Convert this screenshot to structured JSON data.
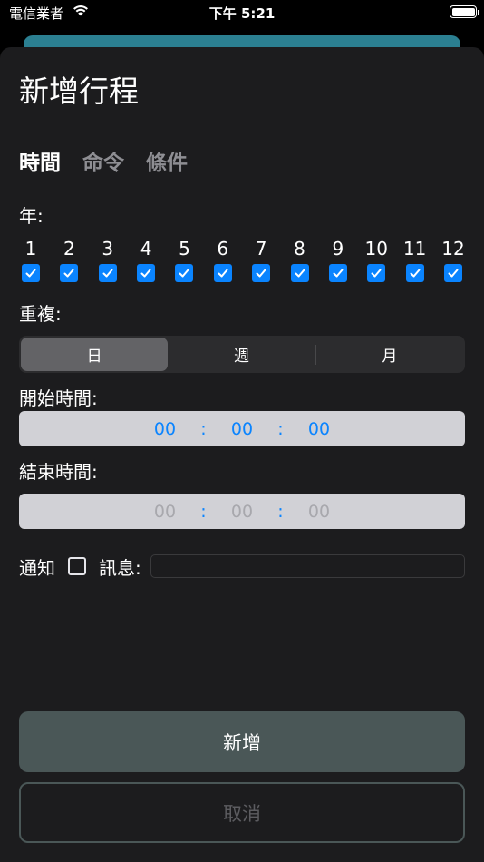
{
  "status_bar": {
    "carrier": "電信業者",
    "time": "下午 5:21"
  },
  "header": {
    "title": "新增行程"
  },
  "tabs": [
    {
      "label": "時間",
      "active": true
    },
    {
      "label": "命令",
      "active": false
    },
    {
      "label": "條件",
      "active": false
    }
  ],
  "year": {
    "label": "年:",
    "months": [
      "1",
      "2",
      "3",
      "4",
      "5",
      "6",
      "7",
      "8",
      "9",
      "10",
      "11",
      "12"
    ],
    "checked": [
      true,
      true,
      true,
      true,
      true,
      true,
      true,
      true,
      true,
      true,
      true,
      true
    ]
  },
  "repeat": {
    "label": "重複:",
    "options": [
      "日",
      "週",
      "月"
    ],
    "selected": "日"
  },
  "start_time": {
    "label": "開始時間:",
    "hh": "00",
    "mm": "00",
    "ss": "00"
  },
  "end_time": {
    "label": "結束時間:",
    "hh": "00",
    "mm": "00",
    "ss": "00"
  },
  "notify": {
    "label": "通知",
    "checked": false,
    "message_label": "訊息:",
    "message_value": ""
  },
  "buttons": {
    "add": "新增",
    "cancel": "取消"
  },
  "colors": {
    "accent": "#0a84ff",
    "add_button": "#4a5757",
    "sheet": "#1c1c1e"
  }
}
